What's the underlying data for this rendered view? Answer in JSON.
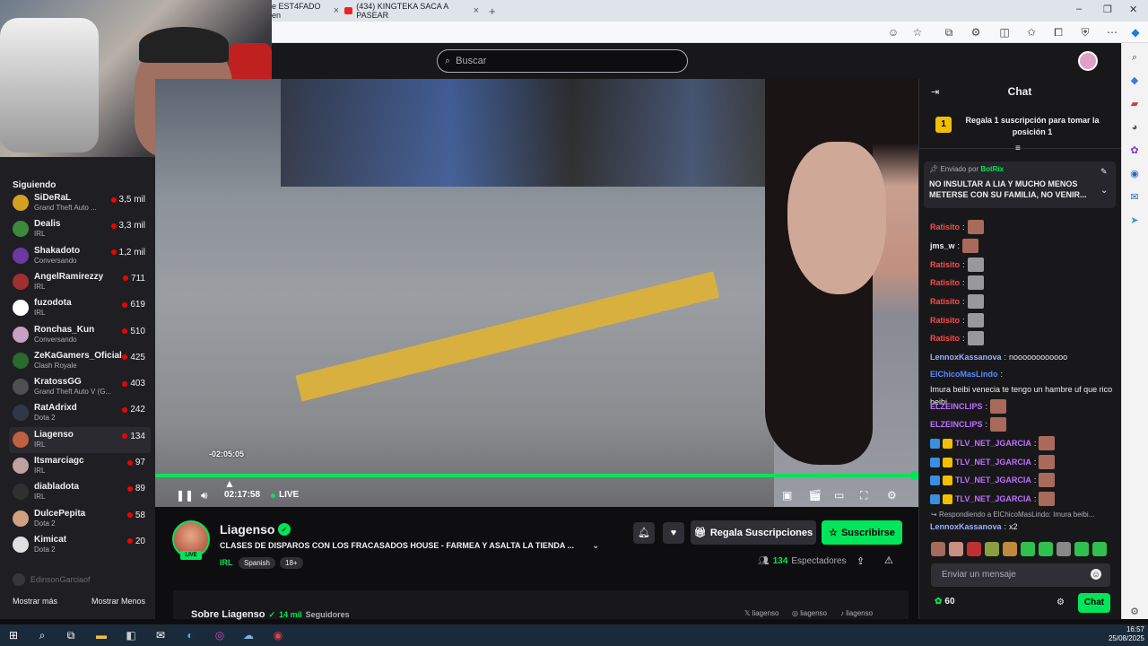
{
  "browser": {
    "tabs": [
      {
        "label": "e EST4FADO en",
        "close": "×"
      },
      {
        "label": "(434) KINGTEKA SACA A PASEAR",
        "close": "×"
      }
    ],
    "new_tab": "+",
    "window_controls": [
      "–",
      "❐",
      "✕"
    ]
  },
  "nav": {
    "search_placeholder": "Buscar"
  },
  "sidebar": {
    "header": "Siguiendo",
    "items": [
      {
        "name": "SiDeRaL",
        "game": "Grand Theft Auto ...",
        "viewers": "3,5 mil",
        "color": "#d4a020"
      },
      {
        "name": "Dealis",
        "game": "IRL",
        "viewers": "3,3 mil",
        "color": "#3a8a3a"
      },
      {
        "name": "Shakadoto",
        "game": "Conversando",
        "viewers": "1,2 mil",
        "color": "#6a3aa0"
      },
      {
        "name": "AngelRamirezzy",
        "game": "IRL",
        "viewers": "711",
        "color": "#a03030"
      },
      {
        "name": "fuzodota",
        "game": "IRL",
        "viewers": "619",
        "color": "#ffffff"
      },
      {
        "name": "Ronchas_Kun",
        "game": "Conversando",
        "viewers": "510",
        "color": "#c8a0c0"
      },
      {
        "name": "ZeKaGamers_Oficial",
        "game": "Clash Royale",
        "viewers": "425",
        "color": "#2a6a2a"
      },
      {
        "name": "KratossGG",
        "game": "Grand Theft Auto V (G...",
        "viewers": "403",
        "color": "#505050"
      },
      {
        "name": "RatAdrixd",
        "game": "Dota 2",
        "viewers": "242",
        "color": "#303848"
      },
      {
        "name": "Liagenso",
        "game": "IRL",
        "viewers": "134",
        "color": "#c06040",
        "selected": true
      },
      {
        "name": "Itsmarciagc",
        "game": "IRL",
        "viewers": "97",
        "color": "#c0a0a0"
      },
      {
        "name": "diabladota",
        "game": "IRL",
        "viewers": "89",
        "color": "#303030"
      },
      {
        "name": "DulcePepita",
        "game": "Dota 2",
        "viewers": "58",
        "color": "#d0a080"
      },
      {
        "name": "Kimicat",
        "game": "Dota 2",
        "viewers": "20",
        "color": "#e0e0e0"
      }
    ],
    "offline_item": "EdinsonGarciaof",
    "show_more": "Mostrar más",
    "show_less": "Mostrar Menos"
  },
  "player": {
    "hover_time": "-02:05:05",
    "elapsed": "02:17:58",
    "live_label": "LIVE",
    "seek_progress": 1.0
  },
  "channel": {
    "name": "Liagenso",
    "live_tag": "LIVE",
    "title": "CLASES DE DISPAROS CON LOS  FRACASADOS HOUSE - FARMEA Y ASALTA LA TIENDA ...",
    "category": "IRL",
    "tags": [
      "Spanish",
      "18+"
    ],
    "gift_label": "Regala Suscripciones",
    "subscribe_label": "Suscribirse",
    "viewers_count": "134",
    "viewers_label": "Espectadores",
    "about_label": "Sobre Liagenso",
    "followers_count": "14 mil",
    "followers_label": "Seguidores",
    "socials": [
      "liagenso",
      "liagenso",
      "liagenso"
    ]
  },
  "chat": {
    "header": "Chat",
    "goal_rank": "1",
    "goal_text": "Regala 1 suscripción para tomar la posición 1",
    "pinned_by_prefix": "Enviado por",
    "pinned_by": "BotRix",
    "pinned_message": "NO INSULTAR A LIA Y MUCHO MENOS METERSE CON SU FAMILIA, NO VENIR...",
    "messages": [
      {
        "user": "Ratisito",
        "text": "",
        "color": "#ff4a4a",
        "emote": "brown"
      },
      {
        "user": "jms_w",
        "text": "",
        "color": "#efeff1",
        "emote": "brown"
      },
      {
        "user": "Ratisito",
        "text": "",
        "color": "#ff4a4a",
        "emote": "gray"
      },
      {
        "user": "Ratisito",
        "text": "",
        "color": "#ff4a4a",
        "emote": "gray"
      },
      {
        "user": "Ratisito",
        "text": "",
        "color": "#ff4a4a",
        "emote": "gray"
      },
      {
        "user": "Ratisito",
        "text": "",
        "color": "#ff4a4a",
        "emote": "gray"
      },
      {
        "user": "Ratisito",
        "text": "",
        "color": "#ff4a4a",
        "emote": "gray"
      },
      {
        "user": "LennoxKassanova",
        "text": "noooooooooooo",
        "color": "#9ab0ff",
        "emote": ""
      },
      {
        "user": "ElChicoMasLindo",
        "text": "Imura beibi venecia te tengo un hambre uf que rico beibi",
        "color": "#5a8aff",
        "emote": ""
      },
      {
        "user": "ELZEINCLIPS",
        "text": "",
        "color": "#c070ff",
        "emote": "brown"
      },
      {
        "user": "ELZEINCLIPS",
        "text": "",
        "color": "#c070ff",
        "emote": "brown"
      },
      {
        "user": "TLV_NET_JGARCIA",
        "text": "",
        "color": "#c070ff",
        "emote": "brown",
        "badges": true
      },
      {
        "user": "TLV_NET_JGARCIA",
        "text": "",
        "color": "#c070ff",
        "emote": "brown",
        "badges": true
      },
      {
        "user": "TLV_NET_JGARCIA",
        "text": "",
        "color": "#c070ff",
        "emote": "brown",
        "badges": true
      },
      {
        "user": "TLV_NET_JGARCIA",
        "text": "",
        "color": "#c070ff",
        "emote": "brown",
        "badges": true
      }
    ],
    "reply_context": "Respondiendo a ElChicoMasLindo: Imura beibi...",
    "last_user": "LennoxKassanova",
    "last_text": "x2",
    "input_placeholder": "Enviar un mensaje",
    "points": "60",
    "send_label": "Chat"
  },
  "taskbar": {
    "time": "16:57",
    "date": "25/08/2025"
  },
  "colors": {
    "accent": "#00e65a",
    "bg": "#0e0e10",
    "panel": "#18181b"
  }
}
